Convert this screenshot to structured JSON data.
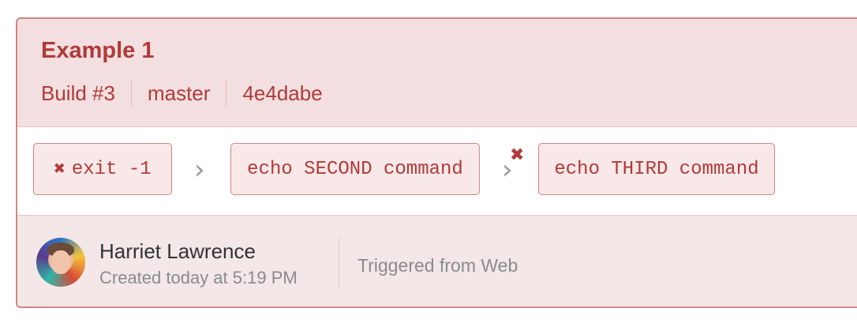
{
  "pipeline": {
    "title": "Example 1",
    "build": "Build #3",
    "branch": "master",
    "commit": "4e4dabe"
  },
  "steps": [
    {
      "label": "exit -1",
      "status": "failed",
      "fail_icon": "✖"
    },
    {
      "label": "echo SECOND command",
      "status": "not-run"
    },
    {
      "label": "echo THIRD command",
      "status": "not-run"
    }
  ],
  "chevrons": {
    "glyph": "›"
  },
  "fail_marker": "✖",
  "footer": {
    "user_name": "Harriet Lawrence",
    "created": "Created today at 5:19 PM",
    "trigger": "Triggered from Web"
  },
  "colors": {
    "accent": "#b03a3a",
    "header_bg": "#f4dfe0",
    "border": "#d08585",
    "footer_bg": "#f3e7e7"
  }
}
